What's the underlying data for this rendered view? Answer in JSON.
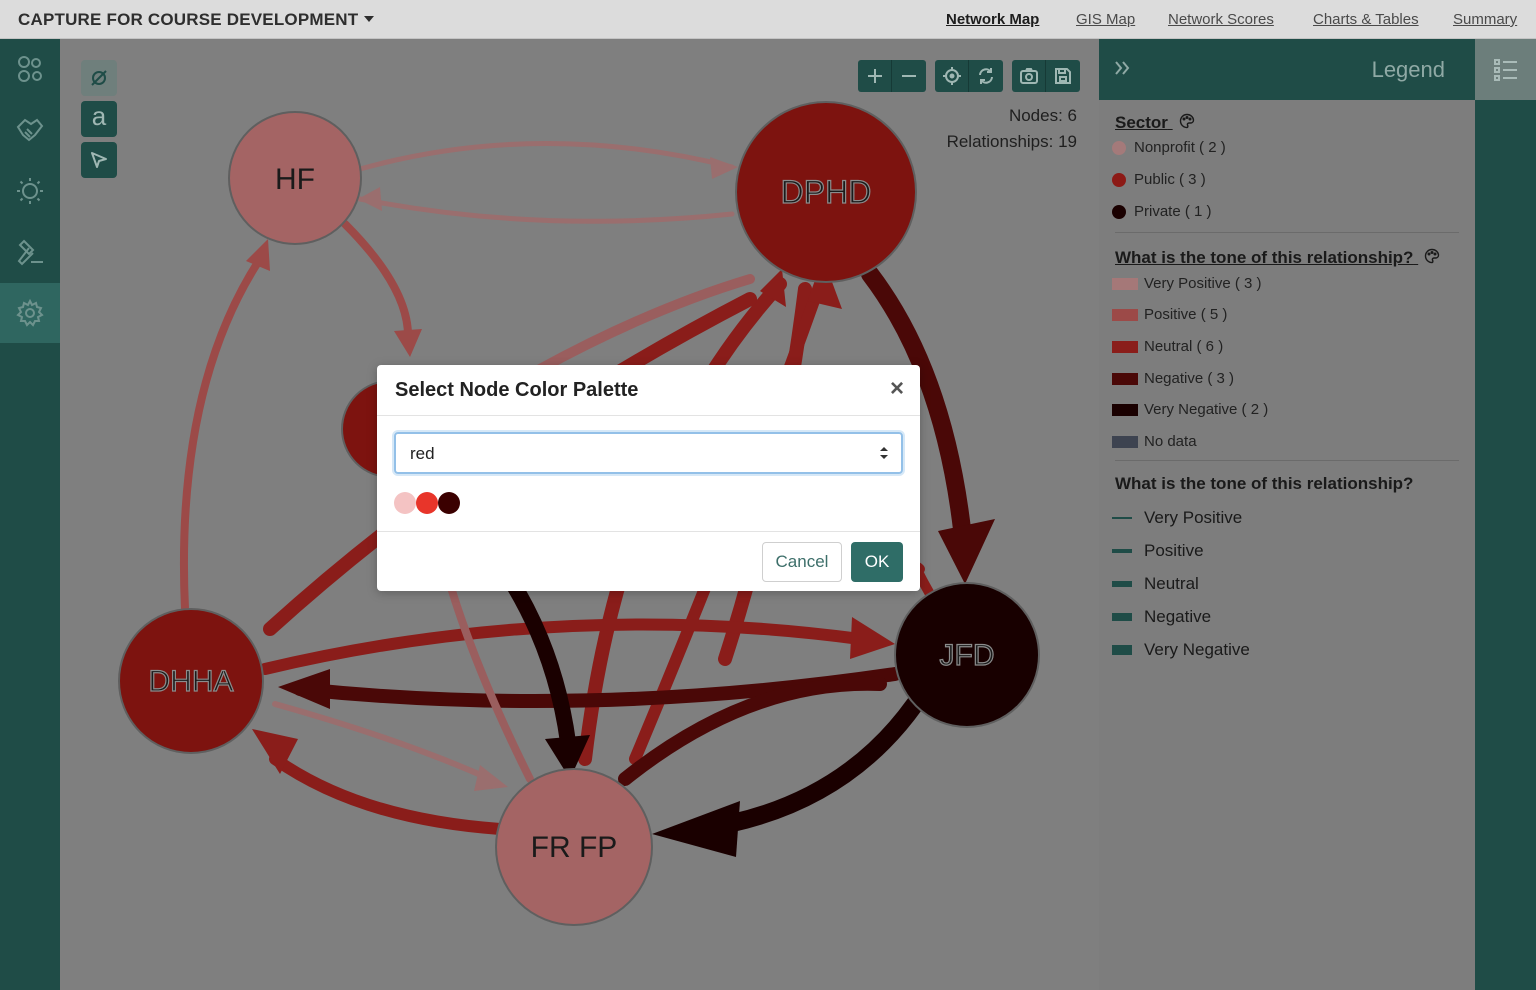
{
  "header": {
    "title": "CAPTURE FOR COURSE DEVELOPMENT",
    "nav": [
      {
        "label": "Network Map"
      },
      {
        "label": "GIS Map"
      },
      {
        "label": "Network Scores"
      },
      {
        "label": "Charts & Tables"
      },
      {
        "label": "Summary"
      }
    ]
  },
  "sidebar": {
    "items": [
      {
        "icon": "network-nodes-icon"
      },
      {
        "icon": "handshake-icon"
      },
      {
        "icon": "lightbulb-icon"
      },
      {
        "icon": "gavel-icon"
      },
      {
        "icon": "gear-icon"
      }
    ]
  },
  "tools": {
    "label_tool": "a"
  },
  "stats": {
    "nodes": "Nodes: 6",
    "relationships": "Relationships: 19"
  },
  "graph": {
    "nodes": [
      {
        "id": "HF",
        "label": "HF",
        "color": "#a46464"
      },
      {
        "id": "DPHD",
        "label": "DPHD",
        "color": "#7d130f"
      },
      {
        "id": "DHHA",
        "label": "DHHA",
        "color": "#7d130f"
      },
      {
        "id": "JFD",
        "label": "JFD",
        "color": "#180000"
      },
      {
        "id": "FRFP",
        "label": "FR FP",
        "color": "#a46464"
      },
      {
        "id": "HIDDEN",
        "label": "",
        "color": "#7d130f"
      }
    ]
  },
  "legend": {
    "title": "Legend",
    "sector": {
      "heading": "Sector",
      "items": [
        {
          "label": "Nonprofit ( 2 )",
          "color": "#a47a7a"
        },
        {
          "label": "Public ( 3 )",
          "color": "#8c1a16"
        },
        {
          "label": "Private ( 1 )",
          "color": "#1a0000"
        }
      ]
    },
    "tone": {
      "heading": "What is the tone of this relationship?",
      "items": [
        {
          "label": "Very Positive ( 3 )",
          "color": "#a57878"
        },
        {
          "label": "Positive ( 5 )",
          "color": "#9c4a48"
        },
        {
          "label": "Neutral ( 6 )",
          "color": "#8a1d1a"
        },
        {
          "label": "Negative ( 3 )",
          "color": "#4a0807"
        },
        {
          "label": "Very Negative ( 2 )",
          "color": "#1a0000"
        },
        {
          "label": "No data",
          "color": "#3d4350"
        }
      ]
    },
    "tone_width": {
      "heading": "What is the tone of this relationship?",
      "items": [
        {
          "label": "Very Positive"
        },
        {
          "label": "Positive"
        },
        {
          "label": "Neutral"
        },
        {
          "label": "Negative"
        },
        {
          "label": "Very Negative"
        }
      ]
    }
  },
  "modal": {
    "title": "Select Node Color Palette",
    "close": "×",
    "select_value": "red",
    "palette": [
      "#f4c3c3",
      "#e8352a",
      "#3b0000"
    ],
    "cancel": "Cancel",
    "ok": "OK"
  }
}
